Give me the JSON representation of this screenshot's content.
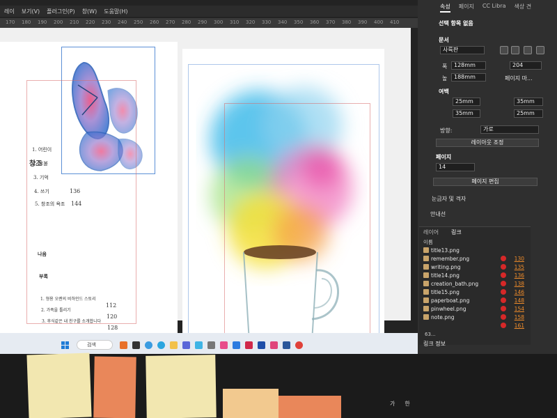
{
  "menubar": {
    "items": [
      "레이",
      "보기(V)",
      "플러그인(P)",
      "창(W)",
      "도움말(H)"
    ]
  },
  "ruler": {
    "ticks": [
      "170",
      "180",
      "190",
      "200",
      "210",
      "220",
      "230",
      "240",
      "250",
      "260",
      "270",
      "280",
      "290",
      "300",
      "310",
      "320",
      "330",
      "340",
      "350",
      "360",
      "370",
      "380",
      "390",
      "400",
      "410"
    ]
  },
  "document": {
    "toc_title": "창조",
    "toc_items": [
      {
        "label": "1. 어린이",
        "num": ""
      },
      {
        "label": "2. 호불",
        "num": ""
      },
      {
        "label": "3. 기억",
        "num": ""
      },
      {
        "label": "4. 쓰기",
        "num": "136"
      },
      {
        "label": "5. 창조의 욕조",
        "num": "144"
      }
    ],
    "nano_label": "나음",
    "appendix_title": "부록",
    "appendix_items": [
      {
        "label": "1. 형용 오렌의 비하인드 스토리",
        "num": "112"
      },
      {
        "label": "2. 가족을 틀리기",
        "num": "120"
      },
      {
        "label": "3. 후식같은 내 친구를 소개합니다",
        "num": "128"
      }
    ]
  },
  "panel": {
    "tabs": [
      "속성",
      "페이지",
      "CC Libra",
      "색상 견"
    ],
    "selection": "선택 항목 없음",
    "document_heading": "문서",
    "preset": "사륙판",
    "width_label": "폭",
    "width_value": "128mm",
    "height_label": "높",
    "height_value": "188mm",
    "pages_value": "204",
    "facing_label": "페이지 마...",
    "margins_heading": "여백",
    "margin_top": "25mm",
    "margin_bottom": "35mm",
    "margin_inside": "35mm",
    "margin_outside": "25mm",
    "orientation_label": "방향:",
    "orientation_value": "가로",
    "adjust_layout_button": "레이아웃 조정",
    "page_heading": "페이지",
    "page_value": "14",
    "edit_page_button": "페이지 편집",
    "rulers_heading": "눈금자 및 격자",
    "guides_heading": "안내선"
  },
  "links": {
    "tabs": [
      "레이어",
      "링크"
    ],
    "name_header": "이름",
    "rows": [
      {
        "name": "title13.png",
        "page": ""
      },
      {
        "name": "remember.png",
        "page": "130"
      },
      {
        "name": "writing.png",
        "page": "135"
      },
      {
        "name": "title14.png",
        "page": "136"
      },
      {
        "name": "creation_bath.png",
        "page": "138"
      },
      {
        "name": "title15.png",
        "page": "146"
      },
      {
        "name": "paperboat.png",
        "page": "148"
      },
      {
        "name": "pinwheel.png",
        "page": "154"
      },
      {
        "name": "note.png",
        "page": "158"
      },
      {
        "name": "",
        "page": "161"
      }
    ],
    "count": "63...",
    "info_label": "링크 정보"
  },
  "taskbar": {
    "search_label": "검색"
  },
  "tray": {
    "ime": "가",
    "lang": "한"
  },
  "colors": {
    "panel_bg": "#2f2f2f",
    "accent_warning": "#d62828",
    "link_page": "#f08c2a"
  }
}
